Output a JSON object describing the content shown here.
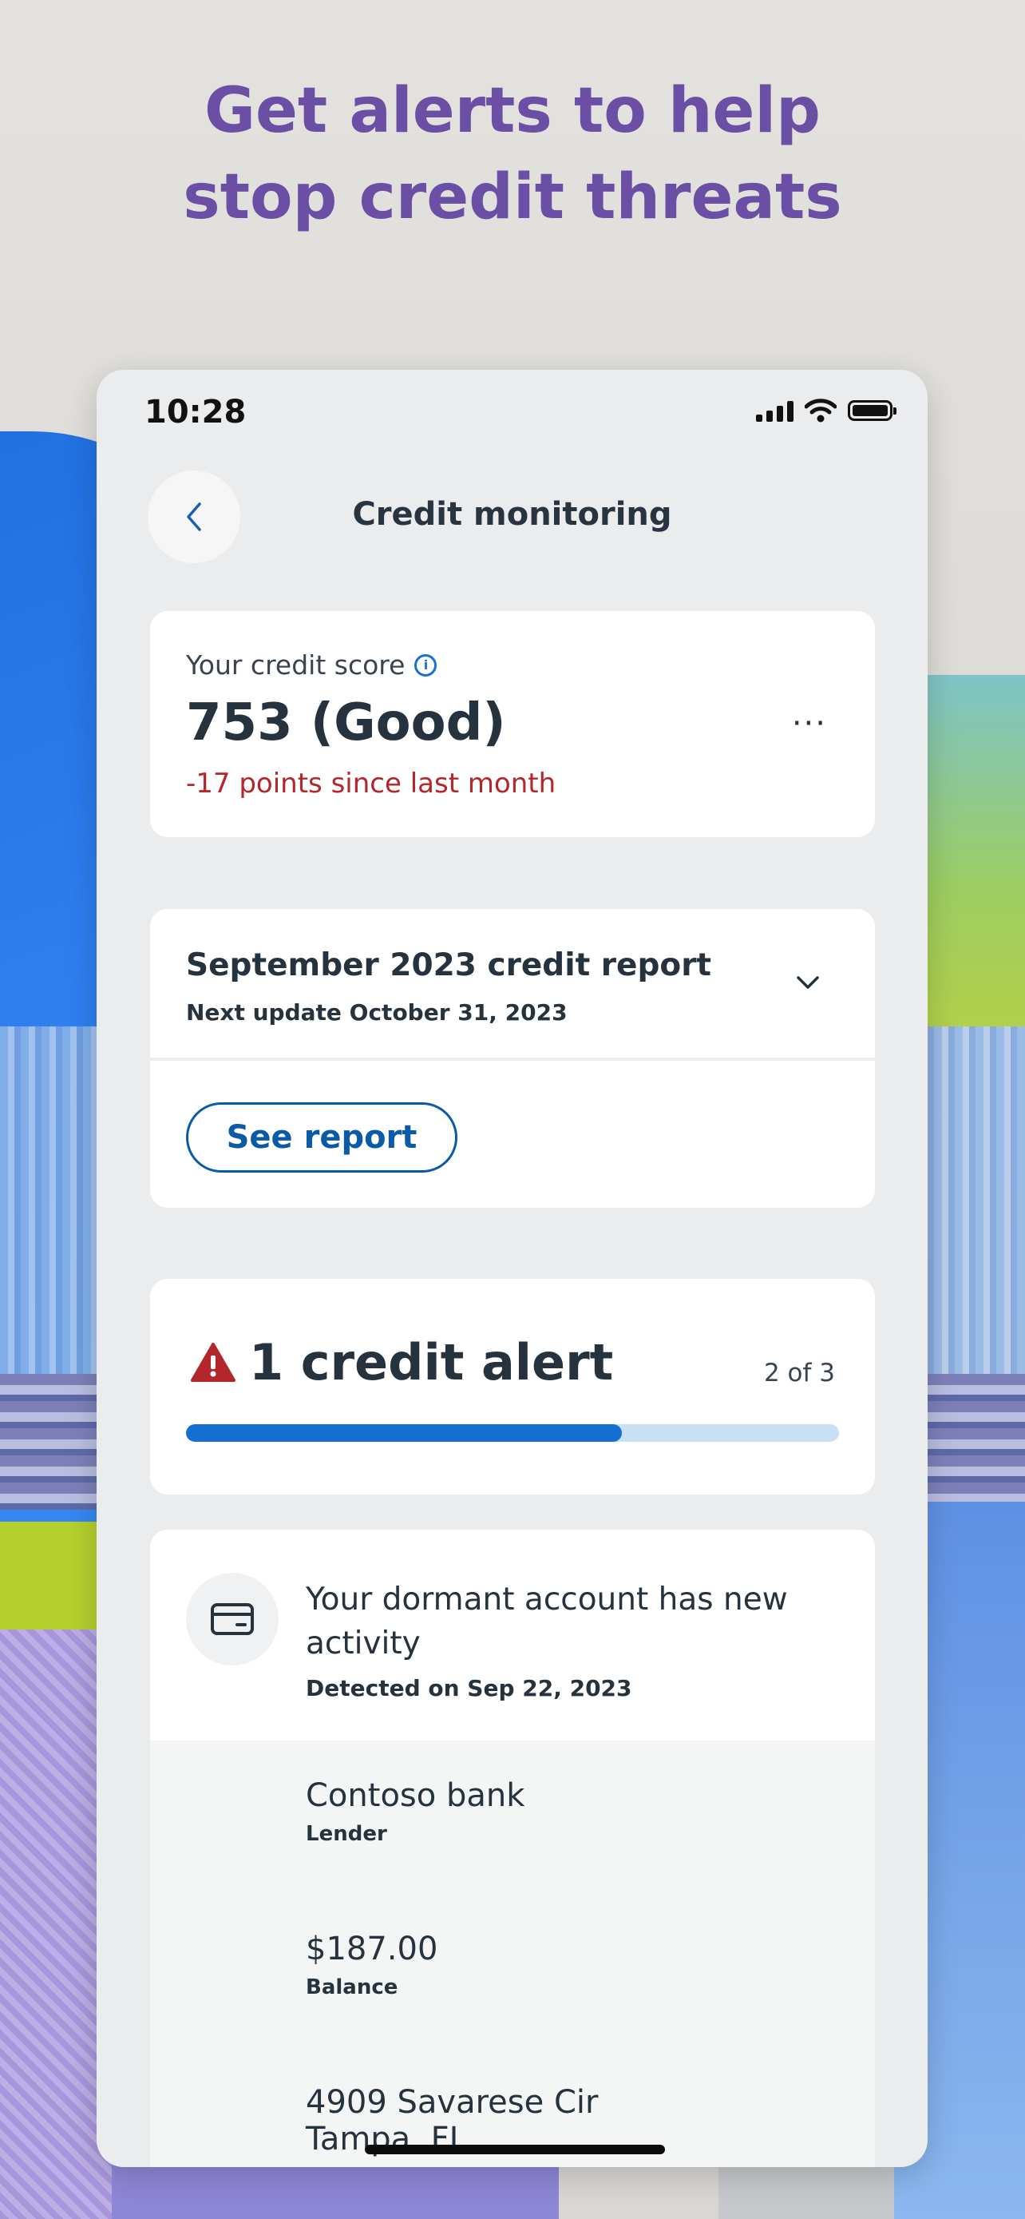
{
  "headline": {
    "line1": "Get alerts to help",
    "line2": "stop credit threats"
  },
  "status_bar": {
    "time": "10:28"
  },
  "nav": {
    "title": "Credit monitoring",
    "back_icon": "chevron-left-icon"
  },
  "score": {
    "label": "Your credit score",
    "value": "753 (Good)",
    "change": "-17 points since last month",
    "change_color": "#b3262b"
  },
  "report": {
    "title": "September 2023 credit report",
    "next_update": "Next update October 31, 2023",
    "button_label": "See report"
  },
  "alerts": {
    "title": "1 credit alert",
    "position": "2 of 3",
    "progress_fraction": 0.667,
    "accent_color": "#136fd0"
  },
  "alert_detail": {
    "title": "Your dormant account has new activity",
    "detected": "Detected on Sep 22, 2023",
    "lender_value": "Contoso bank",
    "lender_label": "Lender",
    "balance_value": "$187.00",
    "balance_label": "Balance",
    "address_line1": "4909 Savarese Cir",
    "address_line2": "Tampa, FL"
  }
}
